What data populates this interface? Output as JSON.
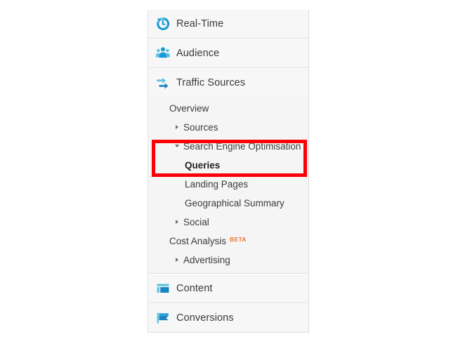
{
  "colors": {
    "accent_blue": "#1b9ad6",
    "accent_blue_light": "#62c3e2",
    "panel_bg": "#f5f5f5",
    "section_bg": "#f7f7f7",
    "highlight_red": "#fb0007",
    "beta_orange": "#e8762c",
    "text": "#3a3a3a"
  },
  "nav": {
    "sections": [
      {
        "id": "real-time",
        "label": "Real-Time",
        "icon": "realtime-clock-icon"
      },
      {
        "id": "audience",
        "label": "Audience",
        "icon": "people-group-icon"
      },
      {
        "id": "traffic-sources",
        "label": "Traffic Sources",
        "icon": "two-arrows-icon"
      },
      {
        "id": "content",
        "label": "Content",
        "icon": "page-layout-icon"
      },
      {
        "id": "conversions",
        "label": "Conversions",
        "icon": "flag-icon"
      }
    ],
    "traffic_sources_items": [
      {
        "id": "overview",
        "label": "Overview",
        "level": 1,
        "disclosure": "none",
        "selected": false,
        "badge": ""
      },
      {
        "id": "sources",
        "label": "Sources",
        "level": 1,
        "disclosure": "closed",
        "selected": false,
        "badge": ""
      },
      {
        "id": "search-engine-optimisation",
        "label": "Search Engine Optimisation",
        "level": 1,
        "disclosure": "open",
        "selected": false,
        "badge": ""
      },
      {
        "id": "queries",
        "label": "Queries",
        "level": 2,
        "disclosure": "none",
        "selected": true,
        "badge": ""
      },
      {
        "id": "landing-pages",
        "label": "Landing Pages",
        "level": 2,
        "disclosure": "none",
        "selected": false,
        "badge": ""
      },
      {
        "id": "geographical-summary",
        "label": "Geographical Summary",
        "level": 2,
        "disclosure": "none",
        "selected": false,
        "badge": ""
      },
      {
        "id": "social",
        "label": "Social",
        "level": 1,
        "disclosure": "closed",
        "selected": false,
        "badge": ""
      },
      {
        "id": "cost-analysis",
        "label": "Cost Analysis",
        "level": 1,
        "disclosure": "none",
        "selected": false,
        "badge": "BETA"
      },
      {
        "id": "advertising",
        "label": "Advertising",
        "level": 1,
        "disclosure": "closed",
        "selected": false,
        "badge": ""
      }
    ]
  }
}
